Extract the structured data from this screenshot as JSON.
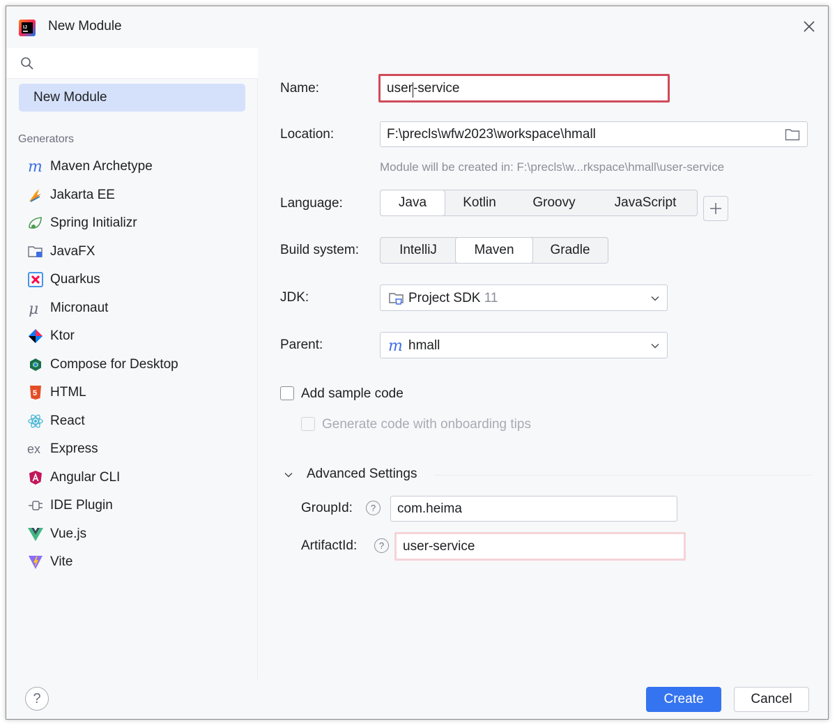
{
  "window": {
    "title": "New Module",
    "app_icon": "intellij-idea-icon",
    "close_icon": "close-icon"
  },
  "sidebar": {
    "search": {
      "value": "",
      "placeholder": ""
    },
    "selected": "New Module",
    "generators_label": "Generators",
    "generators": [
      {
        "label": "Maven Archetype",
        "icon": "maven-icon"
      },
      {
        "label": "Jakarta EE",
        "icon": "jakarta-ee-icon"
      },
      {
        "label": "Spring Initializr",
        "icon": "spring-icon"
      },
      {
        "label": "JavaFX",
        "icon": "javafx-folder-icon"
      },
      {
        "label": "Quarkus",
        "icon": "quarkus-icon"
      },
      {
        "label": "Micronaut",
        "icon": "micronaut-icon"
      },
      {
        "label": "Ktor",
        "icon": "ktor-icon"
      },
      {
        "label": "Compose for Desktop",
        "icon": "compose-icon"
      },
      {
        "label": "HTML",
        "icon": "html5-icon"
      },
      {
        "label": "React",
        "icon": "react-icon"
      },
      {
        "label": "Express",
        "icon": "express-icon"
      },
      {
        "label": "Angular CLI",
        "icon": "angular-icon"
      },
      {
        "label": "IDE Plugin",
        "icon": "plugin-icon"
      },
      {
        "label": "Vue.js",
        "icon": "vue-icon"
      },
      {
        "label": "Vite",
        "icon": "vite-icon"
      }
    ]
  },
  "form": {
    "name_label": "Name:",
    "name_value_before_caret": "user",
    "name_value_after_caret": "-service",
    "location_label": "Location:",
    "location_value": "F:\\precls\\wfw2023\\workspace\\hmall",
    "location_hint": "Module will be created in: F:\\precls\\w...rkspace\\hmall\\user-service",
    "language_label": "Language:",
    "languages": [
      "Java",
      "Kotlin",
      "Groovy",
      "JavaScript"
    ],
    "language_selected": "Java",
    "build_label": "Build system:",
    "build_systems": [
      "IntelliJ",
      "Maven",
      "Gradle"
    ],
    "build_selected": "Maven",
    "jdk_label": "JDK:",
    "jdk_value": "Project SDK",
    "jdk_version": "11",
    "parent_label": "Parent:",
    "parent_value": "hmall",
    "sample_code_label": "Add sample code",
    "onboarding_label": "Generate code with onboarding tips",
    "advanced_label": "Advanced Settings",
    "groupid_label": "GroupId:",
    "groupid_value": "com.heima",
    "artifactid_label": "ArtifactId:",
    "artifactid_value": "user-service",
    "help_glyph": "?"
  },
  "footer": {
    "help_glyph": "?",
    "create_label": "Create",
    "cancel_label": "Cancel"
  },
  "colors": {
    "accent": "#3574f0",
    "selection": "#d5e1fb",
    "error_border": "#d04b5a"
  }
}
